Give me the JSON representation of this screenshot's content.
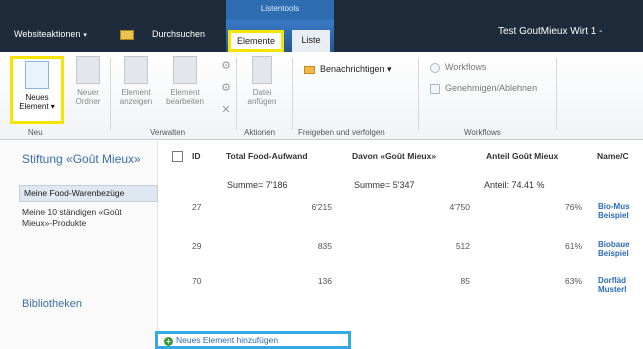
{
  "topbar": {
    "site_actions": "Websiteaktionen",
    "browse": "Durchsuchen",
    "context_group": "Listentools",
    "tabs": [
      {
        "label": "Elemente"
      },
      {
        "label": "Liste"
      }
    ],
    "user": "Test GoutMieux Wirt 1 -"
  },
  "ribbon": {
    "new_item": {
      "line1": "Neues",
      "line2": "Element"
    },
    "new_folder": {
      "line1": "Neuer",
      "line2": "Ordner"
    },
    "view_item": {
      "line1": "Element",
      "line2": "anzeigen"
    },
    "edit_item": {
      "line1": "Element",
      "line2": "bearbeiten"
    },
    "attach_file": {
      "line1": "Datei",
      "line2": "anfügen"
    },
    "notify": "Benachrichtigen",
    "workflows": "Workflows",
    "approve": "Genehmigen/Ablehnen",
    "groups": {
      "neu": "Neu",
      "verwalten": "Verwalten",
      "aktionen": "Aktionen",
      "freigeben": "Freigeben und verfolgen",
      "workflows": "Workflows"
    }
  },
  "nav": {
    "site_title": "Stiftung «Goût Mieux»",
    "selected": "Meine Food-Warenbezüge",
    "item2": "Meine 10 ständigen «Goût Mieux»-Produkte",
    "libraries": "Bibliotheken"
  },
  "table": {
    "headers": [
      "ID",
      "Total Food-Aufwand",
      "Davon «Goût Mieux»",
      "Anteil Goût Mieux",
      "Name/C"
    ],
    "sums": {
      "total": "Summe= 7'186",
      "davon": "Summe= 5'347",
      "anteil": "Anteil: 74.41 %"
    },
    "rows": [
      {
        "id": "27",
        "total": "6'215",
        "davon": "4'750",
        "anteil": "76%",
        "name1": "Bio-Mus",
        "name2": "Beispiel"
      },
      {
        "id": "29",
        "total": "835",
        "davon": "512",
        "anteil": "61%",
        "name1": "Biobaue",
        "name2": "Beispiel"
      },
      {
        "id": "70",
        "total": "136",
        "davon": "85",
        "anteil": "63%",
        "name1": "Dorfläd",
        "name2": "Musterl"
      }
    ],
    "add_item": "Neues Element hinzufügen"
  }
}
